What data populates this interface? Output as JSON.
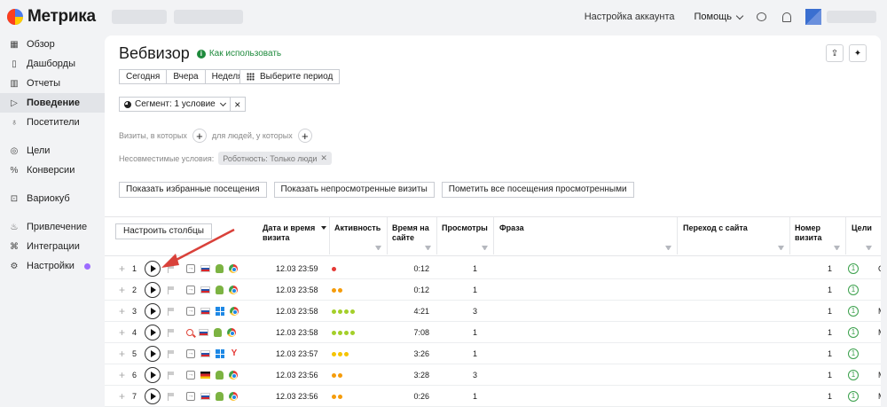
{
  "app": {
    "name": "Метрика"
  },
  "topbar": {
    "account_settings": "Настройка аккаунта",
    "help": "Помощь"
  },
  "sidebar": {
    "items": [
      {
        "label": "Обзор",
        "icon": "grid-icon"
      },
      {
        "label": "Дашборды",
        "icon": "dashboard-icon"
      },
      {
        "label": "Отчеты",
        "icon": "bar-chart-icon"
      },
      {
        "label": "Поведение",
        "icon": "play-outline-icon",
        "active": true
      },
      {
        "label": "Посетители",
        "icon": "person-icon"
      },
      {
        "label": "Цели",
        "icon": "target-icon"
      },
      {
        "label": "Конверсии",
        "icon": "percent-icon"
      },
      {
        "label": "Вариокуб",
        "icon": "cube-icon"
      },
      {
        "label": "Привлечение",
        "icon": "fire-icon"
      },
      {
        "label": "Интеграции",
        "icon": "integrations-icon"
      },
      {
        "label": "Настройки",
        "icon": "gear-icon"
      }
    ]
  },
  "page": {
    "title": "Вебвизор",
    "how_to": "Как использовать"
  },
  "periods": [
    "Сегодня",
    "Вчера",
    "Неделя"
  ],
  "period_picker": "Выберите период",
  "segment": {
    "label": "Сегмент: 1 условие"
  },
  "conditions": {
    "visits_label": "Визиты, в которых",
    "people_label": "для людей, у которых",
    "incompatible_label": "Несовместимые условия:",
    "incompatible_chip": "Роботность: Только люди"
  },
  "actions": [
    "Показать избранные посещения",
    "Показать непросмотренные визиты",
    "Пометить все посещения просмотренными"
  ],
  "table": {
    "configure_columns": "Настроить столбцы",
    "headers": {
      "date": "Дата и время визита",
      "activity": "Активность",
      "time": "Время на сайте",
      "views": "Просмотры",
      "phrase": "Фраза",
      "referrer": "Переход с сайта",
      "visit_number": "Номер визита",
      "goals": "Цели"
    },
    "rows": [
      {
        "num": "1",
        "source": "direct",
        "flag": "ru",
        "os": "android",
        "browser": "chrome",
        "date": "12.03 23:59",
        "activity": 1,
        "time": "0:12",
        "views": "1",
        "visit": "1",
        "goals": "1",
        "trunc": "С"
      },
      {
        "num": "2",
        "source": "internal",
        "flag": "ru",
        "os": "android",
        "browser": "chrome",
        "date": "12.03 23:58",
        "activity": 2,
        "time": "0:12",
        "views": "1",
        "visit": "1",
        "goals": "1",
        "trunc": ""
      },
      {
        "num": "3",
        "source": "internal",
        "flag": "ru",
        "os": "windows",
        "browser": "chrome",
        "date": "12.03 23:58",
        "activity": 4,
        "time": "4:21",
        "views": "3",
        "visit": "1",
        "goals": "1",
        "trunc": "М"
      },
      {
        "num": "4",
        "source": "search",
        "flag": "ru",
        "os": "android",
        "browser": "chrome",
        "date": "12.03 23:58",
        "activity": 4,
        "time": "7:08",
        "views": "1",
        "visit": "1",
        "goals": "1",
        "trunc": "М"
      },
      {
        "num": "5",
        "source": "internal",
        "flag": "ru",
        "os": "windows",
        "browser": "yandex",
        "date": "12.03 23:57",
        "activity": 3,
        "time": "3:26",
        "views": "1",
        "visit": "1",
        "goals": "1",
        "trunc": ""
      },
      {
        "num": "6",
        "source": "internal",
        "flag": "de",
        "os": "android",
        "browser": "chrome",
        "date": "12.03 23:56",
        "activity": 2,
        "time": "3:28",
        "views": "3",
        "visit": "1",
        "goals": "1",
        "trunc": "М"
      },
      {
        "num": "7",
        "source": "internal",
        "flag": "ru",
        "os": "android",
        "browser": "chrome",
        "date": "12.03 23:56",
        "activity": 2,
        "time": "0:26",
        "views": "1",
        "visit": "1",
        "goals": "1",
        "trunc": "М"
      }
    ]
  },
  "colors": {
    "accent_green": "#1e8a3c",
    "activity_1": "#e53935",
    "activity_2": "#f59c0b",
    "activity_3": "#f5c400",
    "activity_4": "#a4cf2a",
    "annotation_arrow": "#d9413a"
  }
}
